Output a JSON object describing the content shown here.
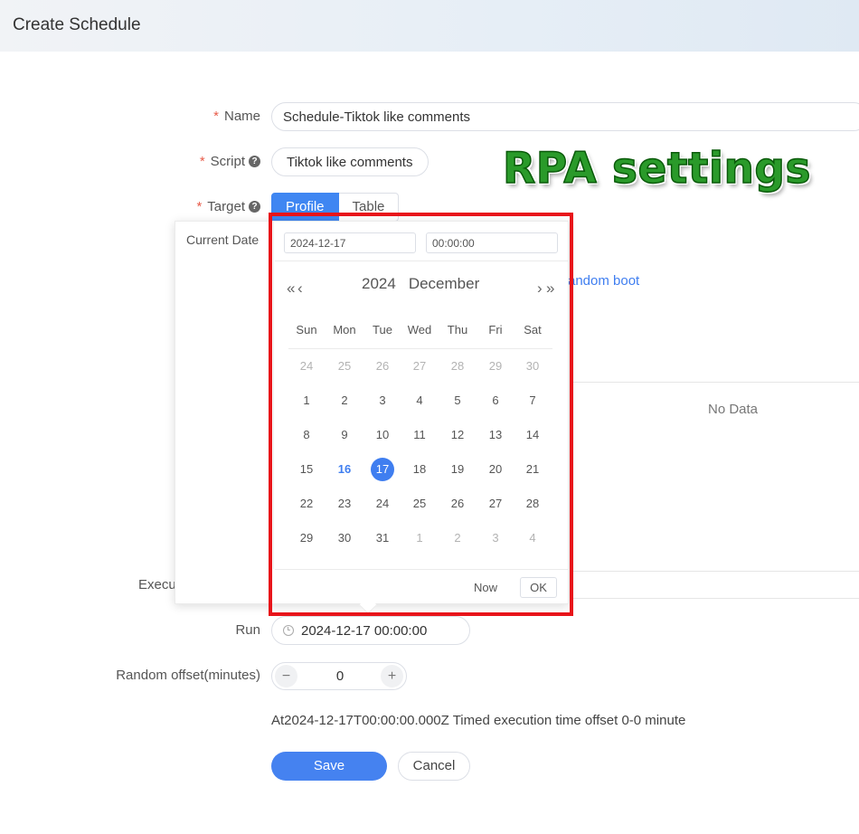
{
  "header": {
    "title": "Create Schedule"
  },
  "form": {
    "name_label": "Name",
    "name_value": "Schedule-Tiktok like comments",
    "script_label": "Script",
    "script_value": "Tiktok like comments",
    "target_label": "Target",
    "target_options": [
      "Profile",
      "Table"
    ],
    "target_selected": "Profile",
    "partial_link": "andom boot",
    "no_data": "No Data",
    "execute_label_partial": "Execu",
    "run_label": "Run",
    "run_value": "2024-12-17 00:00:00",
    "offset_label": "Random offset(minutes)",
    "offset_value": "0",
    "summary": "At2024-12-17T00:00:00.000Z Timed execution time offset 0-0 minute",
    "save": "Save",
    "cancel": "Cancel"
  },
  "overlay_text": "RPA settings",
  "picker": {
    "side_label": "Current Date",
    "date_value": "2024-12-17",
    "time_value": "00:00:00",
    "year": "2024",
    "month": "December",
    "weekdays": [
      "Sun",
      "Mon",
      "Tue",
      "Wed",
      "Thu",
      "Fri",
      "Sat"
    ],
    "weeks": [
      [
        "24",
        "25",
        "26",
        "27",
        "28",
        "29",
        "30"
      ],
      [
        "1",
        "2",
        "3",
        "4",
        "5",
        "6",
        "7"
      ],
      [
        "8",
        "9",
        "10",
        "11",
        "12",
        "13",
        "14"
      ],
      [
        "15",
        "16",
        "17",
        "18",
        "19",
        "20",
        "21"
      ],
      [
        "22",
        "23",
        "24",
        "25",
        "26",
        "27",
        "28"
      ],
      [
        "29",
        "30",
        "31",
        "1",
        "2",
        "3",
        "4"
      ]
    ],
    "today": "16",
    "selected": "17",
    "now_label": "Now",
    "ok_label": "OK"
  },
  "colors": {
    "accent": "#3f7ef0",
    "highlight_box": "#e8141a",
    "overlay_text": "#2a9a2a"
  }
}
